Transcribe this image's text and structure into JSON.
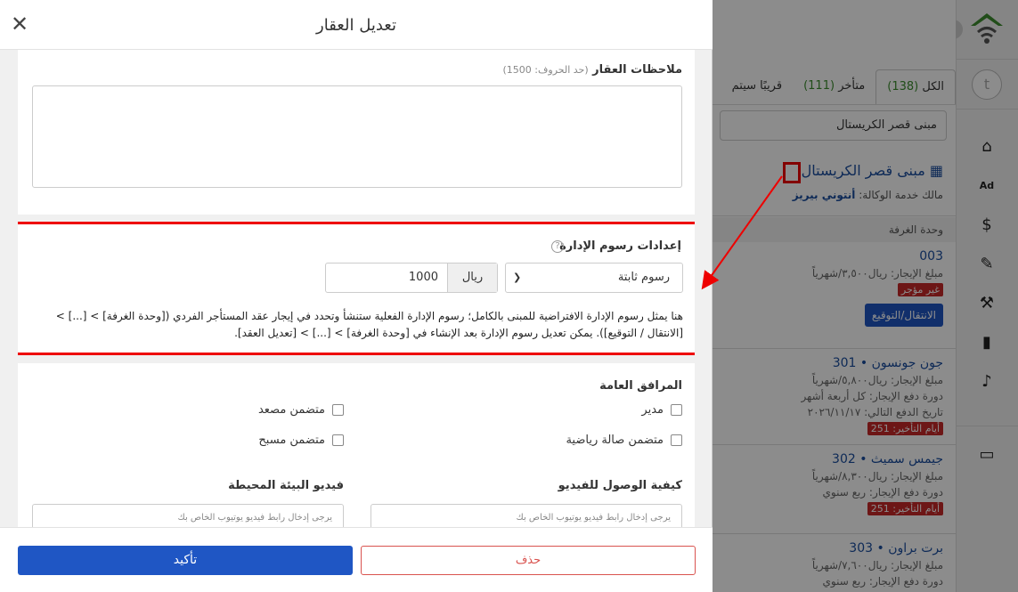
{
  "modal": {
    "title": "تعديل العقار",
    "notes": {
      "label": "ملاحظات العقار",
      "hint": "(حد الحروف: 1500)"
    },
    "management_fee": {
      "label": "إعدادات رسوم الإدارة",
      "type_value": "رسوم ثابتة",
      "currency_label": "ريال",
      "amount": "1000",
      "description": "هنا يمثل رسوم الإدارة الافتراضية للمبنى بالكامل؛ رسوم الإدارة الفعلية ستنشأ وتحدد في إيجار عقد المستأجر الفردي ([وحدة الغرفة] > [...] > [الانتقال / التوقيع]). يمكن تعديل رسوم الإدارة بعد الإنشاء في [وحدة الغرفة] > [...] > [تعديل العقد]."
    },
    "amenities": {
      "label": "المرافق العامة",
      "items": [
        "مدير",
        "متضمن مصعد",
        "متضمن صالة رياضية",
        "متضمن مسبح"
      ]
    },
    "video_access": {
      "label": "كيفية الوصول للفيديو",
      "placeholder": "يرجى إدخال رابط فيديو يوتيوب الخاص بك"
    },
    "ambient_video": {
      "label": "فيديو البيئة المحيطة",
      "placeholder": "يرجى إدخال رابط فيديو يوتيوب الخاص بك"
    },
    "delete_label": "حذف",
    "confirm_label": "تأكيد"
  },
  "list": {
    "tabs": [
      {
        "label": "الكل",
        "count": "(138)"
      },
      {
        "label": "متأخر",
        "count": "(111)"
      },
      {
        "label": "قريبًا سيتم",
        "count": ""
      }
    ],
    "building_filter": "مبنى قصر الكريستال",
    "building": {
      "name": "مبنى قصر الكريستال",
      "owner_prefix": "مالك خدمة الوكالة:",
      "owner_name": "أنتوني بيريز"
    },
    "section_header": "وحدة الغرفة",
    "units": [
      {
        "title": "003",
        "rent": "مبلغ الإيجار: ريال٣,٥٠٠/شهرياً",
        "badge": "غير مؤجر",
        "action": "الانتقال/التوقيع"
      },
      {
        "title": "301 • جون جونسون",
        "rent": "مبلغ الإيجار: ريال٥,٨٠٠/شهرياً",
        "cycle": "دورة دفع الإيجار: كل أربعة أشهر",
        "next": "تاريخ الدفع التالي: ٢٠٢٦/١١/١٧",
        "badge": "أيام التأخير: 251"
      },
      {
        "title": "302 • جيمس سميث",
        "rent": "مبلغ الإيجار: ريال٨,٣٠٠/شهرياً",
        "cycle": "دورة دفع الإيجار: ربع سنوي",
        "badge": "أيام التأخير: 251"
      },
      {
        "title": "303 • برت براون",
        "rent": "مبلغ الإيجار: ريال٧,٦٠٠/شهرياً",
        "cycle": "دورة دفع الإيجار: ربع سنوي"
      }
    ]
  },
  "rail": {
    "avatar_letter": "t",
    "icons": [
      "home-icon",
      "ad-icon",
      "dollar-icon",
      "edit-doc-icon",
      "wrench-icon",
      "chart-icon",
      "bell-icon",
      "bed-icon"
    ]
  },
  "colors": {
    "primary": "#1f56c4",
    "danger": "#d9534f",
    "highlight": "#e00000",
    "link": "#1a4d9e"
  }
}
